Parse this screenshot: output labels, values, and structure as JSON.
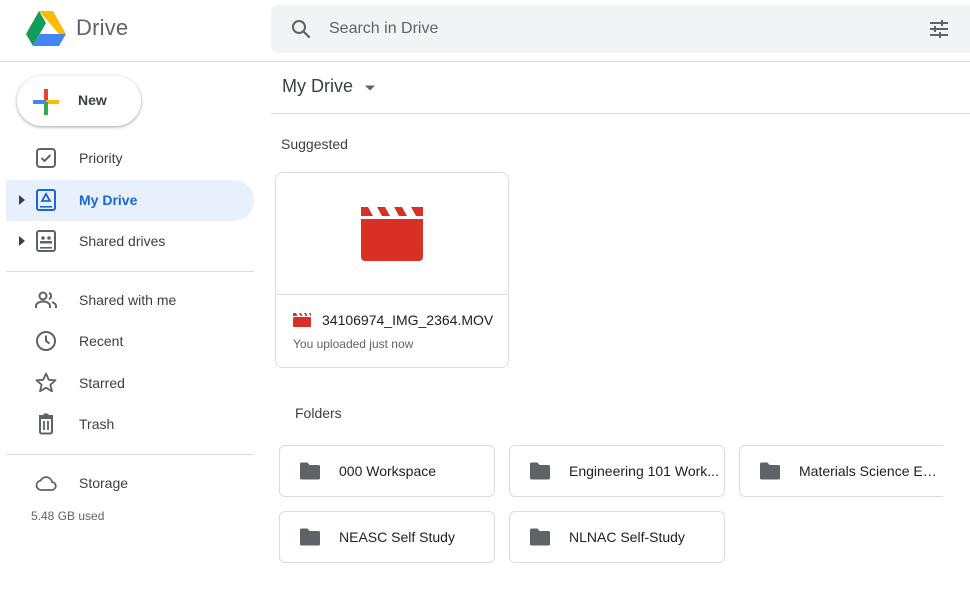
{
  "header": {
    "brand": "Drive",
    "search_placeholder": "Search in Drive"
  },
  "sidebar": {
    "new_label": "New",
    "items": [
      {
        "label": "Priority",
        "icon": "priority-icon"
      },
      {
        "label": "My Drive",
        "icon": "my-drive-icon",
        "active": true
      },
      {
        "label": "Shared drives",
        "icon": "shared-drives-icon"
      },
      {
        "label": "Shared with me",
        "icon": "shared-with-me-icon"
      },
      {
        "label": "Recent",
        "icon": "recent-icon"
      },
      {
        "label": "Starred",
        "icon": "star-icon"
      },
      {
        "label": "Trash",
        "icon": "trash-icon"
      },
      {
        "label": "Storage",
        "icon": "cloud-icon"
      }
    ],
    "storage_used": "5.48 GB used"
  },
  "main": {
    "title": "My Drive",
    "suggested_label": "Suggested",
    "suggested": [
      {
        "name": "34106974_IMG_2364.MOV",
        "subtitle": "You uploaded just now",
        "icon": "video-file-icon"
      }
    ],
    "folders_label": "Folders",
    "folders": [
      {
        "name": "000 Workspace"
      },
      {
        "name": "Engineering 101 Work..."
      },
      {
        "name": "Materials Science En..."
      },
      {
        "name": "NEASC Self Study"
      },
      {
        "name": "NLNAC Self-Study"
      }
    ]
  },
  "colors": {
    "accent": "#1967d2",
    "active_bg": "#e8f0fe",
    "video_red": "#d93025",
    "folder_gray": "#5f6368",
    "border": "#dadce0"
  }
}
